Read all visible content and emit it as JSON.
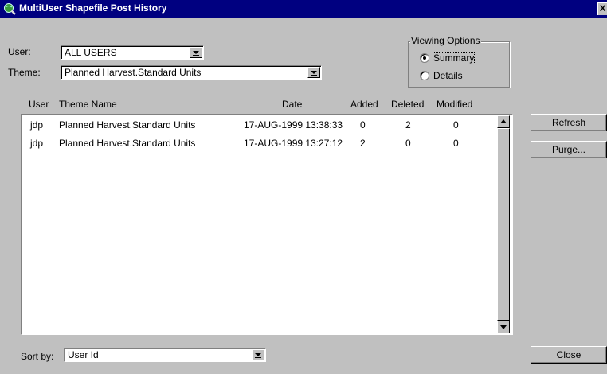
{
  "window": {
    "title": "MultiUser Shapefile Post History",
    "close_glyph": "X"
  },
  "user": {
    "label": "User:",
    "value": "ALL USERS"
  },
  "theme": {
    "label": "Theme:",
    "value": "Planned Harvest.Standard Units"
  },
  "viewing_options": {
    "legend": "Viewing Options",
    "summary_label": "Summary",
    "details_label": "Details",
    "selected": "Summary"
  },
  "table": {
    "columns": [
      "User",
      "Theme Name",
      "Date",
      "Added",
      "Deleted",
      "Modified"
    ],
    "rows": [
      [
        "jdp",
        "Planned Harvest.Standard Units",
        "17-AUG-1999 13:38:33",
        "0",
        "2",
        "0"
      ],
      [
        "jdp",
        "Planned Harvest.Standard Units",
        "17-AUG-1999 13:27:12",
        "2",
        "0",
        "0"
      ]
    ]
  },
  "buttons": {
    "refresh": "Refresh",
    "purge": "Purge...",
    "close": "Close"
  },
  "sort": {
    "label": "Sort by:",
    "value": "User Id"
  },
  "icons": {
    "app": "globe-magnifier-icon"
  }
}
